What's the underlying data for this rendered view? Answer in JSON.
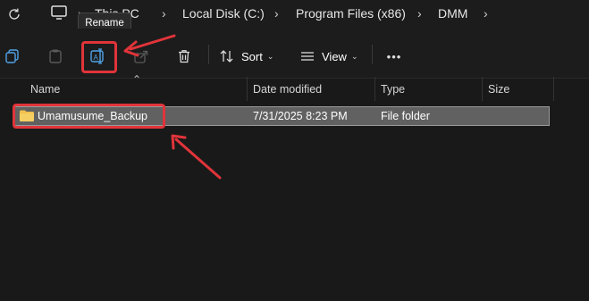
{
  "breadcrumb": {
    "segments": [
      "This PC",
      "Local Disk (C:)",
      "Program Files (x86)",
      "DMM"
    ],
    "separator": "›"
  },
  "icons": {
    "refresh": "refresh-icon",
    "monitor": "monitor-icon",
    "copy": "copy-icon",
    "paste": "paste-icon",
    "rename": "rename-icon",
    "share": "share-icon",
    "delete": "trash-icon",
    "sort": "sort-icon",
    "view": "view-icon",
    "more": "more-icon",
    "folder": "folder-icon"
  },
  "tooltip": {
    "text": "Rename"
  },
  "toolbar": {
    "sort_label": "Sort",
    "view_label": "View",
    "more_label": "•••"
  },
  "columns": {
    "name": "Name",
    "date_modified": "Date modified",
    "type": "Type",
    "size": "Size"
  },
  "files": [
    {
      "name": "Umamusume_Backup",
      "date_modified": "7/31/2025 8:23 PM",
      "type": "File folder",
      "size": ""
    }
  ],
  "colors": {
    "background": "#191919",
    "selection": "#616161",
    "annotation_red": "#e0343a",
    "folder_yellow": "#f2c14e"
  }
}
